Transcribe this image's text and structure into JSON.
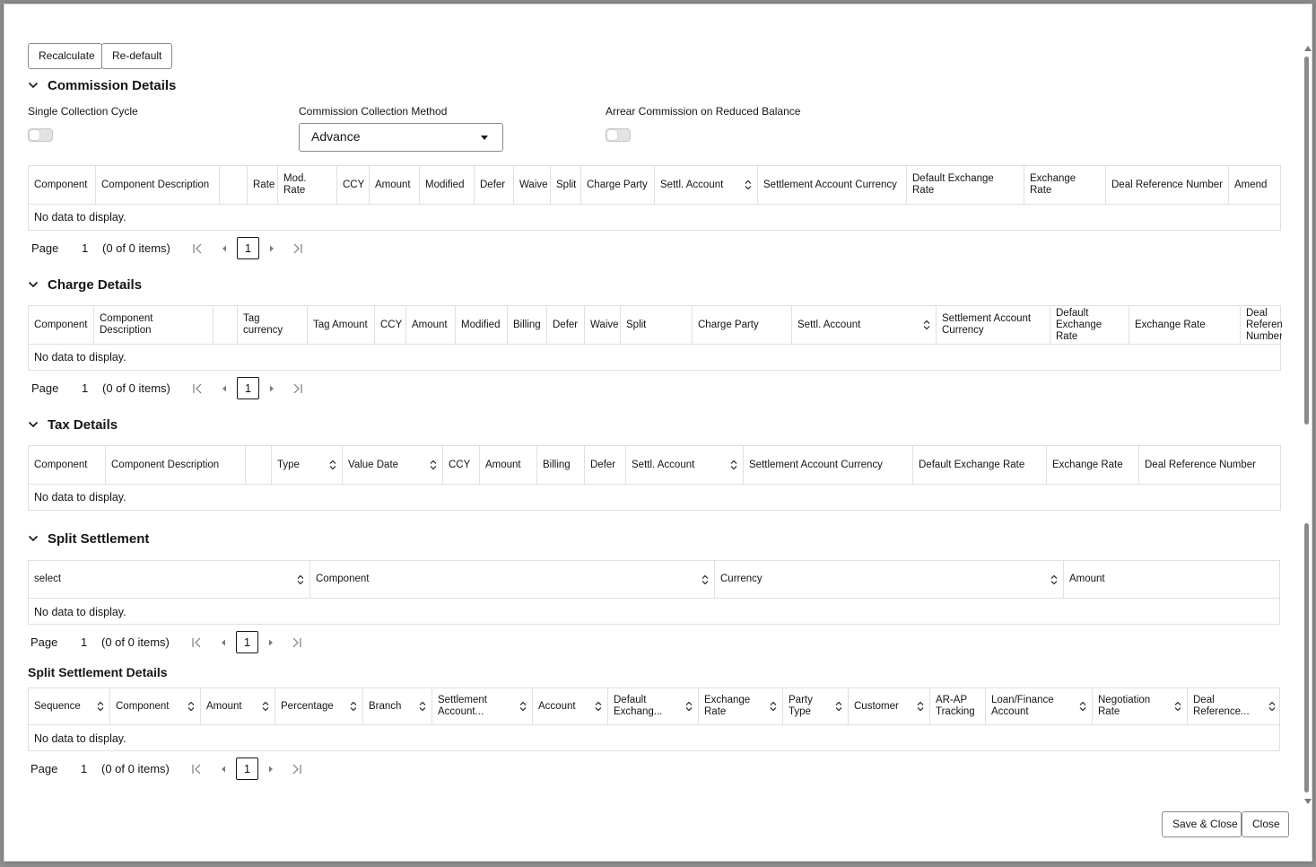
{
  "toolbar": {
    "recalculate": "Recalculate",
    "redefault": "Re-default"
  },
  "commission": {
    "title": "Commission Details",
    "single_cycle_label": "Single Collection Cycle",
    "method_label": "Commission Collection Method",
    "method_value": "Advance",
    "arrear_label": "Arrear Commission on Reduced Balance",
    "single_cycle_on": false,
    "arrear_on": false,
    "columns": [
      "Component",
      "Component Description",
      "",
      "Rate",
      "Mod. Rate",
      "CCY",
      "Amount",
      "Modified",
      "Defer",
      "Waive",
      "Split",
      "Charge Party",
      "Settl. Account",
      "Settlement Account Currency",
      "Default Exchange Rate",
      "Exchange Rate",
      "Deal Reference Number",
      "Amend"
    ],
    "no_data": "No data to display."
  },
  "charge": {
    "title": "Charge Details",
    "columns": [
      "Component",
      "Component Description",
      "",
      "Tag currency",
      "Tag Amount",
      "CCY",
      "Amount",
      "Modified",
      "Billing",
      "Defer",
      "Waive",
      "Split",
      "Charge Party",
      "Settl. Account",
      "Settlement Account Currency",
      "Default Exchange Rate",
      "Exchange Rate",
      "Deal Reference Number"
    ],
    "no_data": "No data to display."
  },
  "tax": {
    "title": "Tax Details",
    "columns": [
      "Component",
      "Component Description",
      "",
      "Type",
      "Value Date",
      "CCY",
      "Amount",
      "Billing",
      "Defer",
      "Settl. Account",
      "Settlement Account Currency",
      "Default Exchange Rate",
      "Exchange Rate",
      "Deal Reference Number"
    ],
    "no_data": "No data to display."
  },
  "split": {
    "title": "Split Settlement",
    "columns": [
      "select",
      "Component",
      "Currency",
      "Amount"
    ],
    "no_data": "No data to display."
  },
  "split_details": {
    "title": "Split Settlement Details",
    "columns": [
      "Sequence",
      "Component",
      "Amount",
      "Percentage",
      "Branch",
      "Settlement Account...",
      "Account",
      "Default Exchang...",
      "Exchange Rate",
      "Party Type",
      "Customer",
      "AR-AP Tracking",
      "Loan/Finance Account",
      "Negotiation Rate",
      "Deal Reference..."
    ],
    "no_data": "No data to display."
  },
  "pager": {
    "page_label": "Page",
    "page_number": "1",
    "items_text": "(0 of 0 items)",
    "current": "1"
  },
  "footer": {
    "save_close": "Save & Close",
    "close": "Close"
  }
}
